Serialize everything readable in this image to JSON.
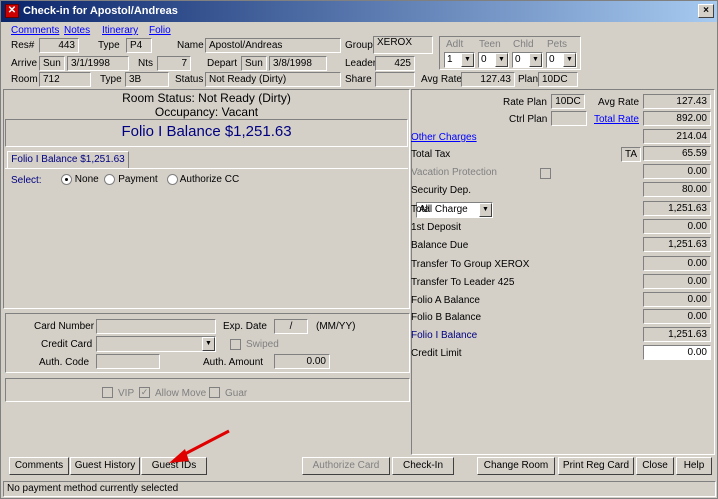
{
  "window": {
    "title": "Check-in for Apostol/Andreas",
    "close": "×"
  },
  "menu": {
    "comments": "Comments",
    "notes": "Notes",
    "itinerary": "Itinerary",
    "folio": "Folio"
  },
  "header": {
    "res_label": "Res#",
    "res": "443",
    "type_label": "Type",
    "type": "P4",
    "name_label": "Name",
    "name": "Apostol/Andreas",
    "group_label": "Group",
    "group": "XEROX",
    "arrive_label": "Arrive",
    "arrive_day": "Sun",
    "arrive_date": "3/1/1998",
    "nts_label": "Nts",
    "nts": "7",
    "depart_label": "Depart",
    "depart_day": "Sun",
    "depart_date": "3/8/1998",
    "leader_label": "Leader",
    "leader": "425",
    "room_label": "Room",
    "room": "712",
    "room_type_label": "Type",
    "room_type": "3B",
    "status_label": "Status",
    "status": "Not Ready (Dirty)",
    "share_label": "Share",
    "share": "",
    "avg_rate_label": "Avg Rate",
    "avg_rate": "127.43",
    "plan_label": "Plan",
    "plan": "10DC",
    "adlt_label": "Adlt",
    "adlt": "1",
    "teen_label": "Teen",
    "teen": "0",
    "chld_label": "Chld",
    "chld": "0",
    "pets_label": "Pets",
    "pets": "0"
  },
  "room_status": {
    "line1": "Room Status: Not Ready (Dirty)",
    "line2": "Occupancy: Vacant"
  },
  "folio_balance": "Folio I Balance $1,251.63",
  "folio_tab": "Folio I Balance $1,251.63",
  "select": {
    "label": "Select:",
    "none": "None",
    "payment": "Payment",
    "authorize": "Authorize CC",
    "selected": "None"
  },
  "card": {
    "number_label": "Card Number",
    "number": "",
    "exp_label": "Exp. Date",
    "exp": "/",
    "exp_fmt": "(MM/YY)",
    "credit_label": "Credit Card",
    "credit": "",
    "swiped_label": "Swiped",
    "auth_code_label": "Auth. Code",
    "auth_code": "",
    "auth_amount_label": "Auth. Amount",
    "auth_amount": "0.00"
  },
  "flags": {
    "vip": "VIP",
    "allow_move": "Allow Move",
    "guar": "Guar"
  },
  "right": {
    "rate_plan_label": "Rate Plan",
    "rate_plan": "10DC",
    "ctrl_plan_label": "Ctrl Plan",
    "ctrl_plan": "",
    "dropdown": "All",
    "rows": [
      {
        "label": "Avg Rate",
        "value": "127.43",
        "style": "plain"
      },
      {
        "label": "Total Rate",
        "value": "892.00",
        "style": "link"
      },
      {
        "label": "Other Charges",
        "value": "214.04",
        "style": "link"
      },
      {
        "label": "Total Tax",
        "value": "65.59",
        "style": "plain"
      },
      {
        "label": "Vacation Protection",
        "value": "0.00",
        "style": "dim"
      },
      {
        "label": "Security Dep.",
        "value": "80.00",
        "style": "plain"
      },
      {
        "label": "Total Charge",
        "value": "1,251.63",
        "style": "plain"
      },
      {
        "label": "1st Deposit",
        "value": "0.00",
        "style": "plain"
      },
      {
        "label": "Balance Due",
        "value": "1,251.63",
        "style": "plain"
      },
      {
        "label": "Transfer To Group XEROX",
        "value": "0.00",
        "style": "plain"
      },
      {
        "label": "Transfer To Leader 425",
        "value": "0.00",
        "style": "plain"
      },
      {
        "label": "Folio A Balance",
        "value": "0.00",
        "style": "plain"
      },
      {
        "label": "Folio B Balance",
        "value": "0.00",
        "style": "plain"
      },
      {
        "label": "Folio I Balance",
        "value": "1,251.63",
        "style": "navy"
      },
      {
        "label": "Credit Limit",
        "value": "0.00",
        "style": "plain"
      }
    ],
    "tax_code": "TA"
  },
  "buttons": {
    "comments": "Comments",
    "guest_history": "Guest History",
    "guest_ids": "Guest IDs",
    "authorize_card": "Authorize Card",
    "check_in": "Check-In",
    "change_room": "Change Room",
    "print_reg_card": "Print Reg Card",
    "close": "Close",
    "help": "Help"
  },
  "status_bar": "No payment method currently selected",
  "colors": {
    "title_start": "#0a246a",
    "title_end": "#a6caf0",
    "annotation_arrow": "#e00000",
    "link": "#0000ff"
  }
}
